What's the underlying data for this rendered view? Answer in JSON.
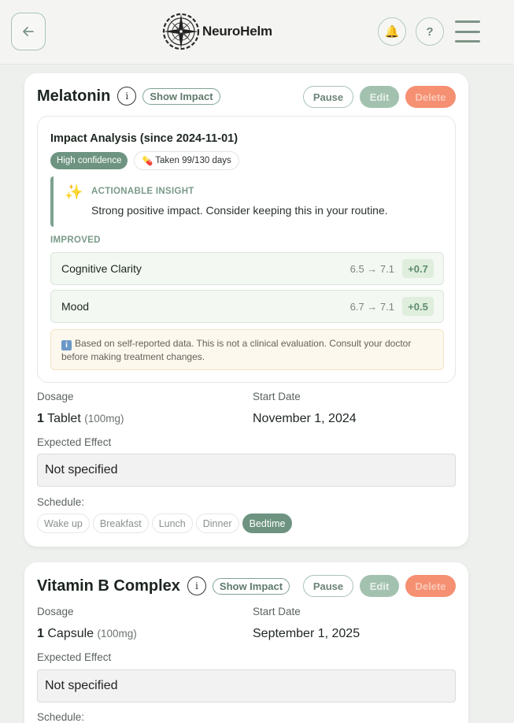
{
  "header": {
    "app_name": "NeuroHelm",
    "back_icon": "arrow-left-icon",
    "bell_icon": "🔔",
    "help_label": "?"
  },
  "supplements": [
    {
      "name": "Melatonin",
      "info_label": "i",
      "show_impact_label": "Show Impact",
      "pause_label": "Pause",
      "edit_label": "Edit",
      "delete_label": "Delete",
      "impact": {
        "title": "Impact Analysis (since 2024-11-01)",
        "confidence_badge": "High confidence",
        "pill_icon": "💊",
        "taken_badge": "Taken 99/130 days",
        "insight_icon": "✨",
        "insight_label": "ACTIONABLE INSIGHT",
        "insight_text": "Strong positive impact. Consider keeping this in your routine.",
        "improved_label": "IMPROVED",
        "metrics": [
          {
            "name": "Cognitive Clarity",
            "values": "6.5 → 7.1",
            "delta": "+0.7"
          },
          {
            "name": "Mood",
            "values": "6.7 → 7.1",
            "delta": "+0.5"
          }
        ],
        "disclaimer_icon": "i",
        "disclaimer": "Based on self-reported data. This is not a clinical evaluation. Consult your doctor before making treatment changes."
      },
      "dosage_label": "Dosage",
      "dosage_qty": "1",
      "dosage_unit": "Tablet",
      "dosage_amount": "(100mg)",
      "start_date_label": "Start Date",
      "start_date": "November 1, 2024",
      "expected_effect_label": "Expected Effect",
      "expected_effect": "Not specified",
      "schedule_label": "Schedule:",
      "schedule": [
        {
          "label": "Wake up",
          "active": false
        },
        {
          "label": "Breakfast",
          "active": false
        },
        {
          "label": "Lunch",
          "active": false
        },
        {
          "label": "Dinner",
          "active": false
        },
        {
          "label": "Bedtime",
          "active": true
        }
      ]
    },
    {
      "name": "Vitamin B Complex",
      "info_label": "i",
      "show_impact_label": "Show Impact",
      "pause_label": "Pause",
      "edit_label": "Edit",
      "delete_label": "Delete",
      "dosage_label": "Dosage",
      "dosage_qty": "1",
      "dosage_unit": "Capsule",
      "dosage_amount": "(100mg)",
      "start_date_label": "Start Date",
      "start_date": "September 1, 2025",
      "expected_effect_label": "Expected Effect",
      "expected_effect": "Not specified",
      "schedule_label": "Schedule:"
    }
  ],
  "colors": {
    "accent": "#6e9481",
    "delete": "#f59072",
    "background": "#eef0ee"
  }
}
